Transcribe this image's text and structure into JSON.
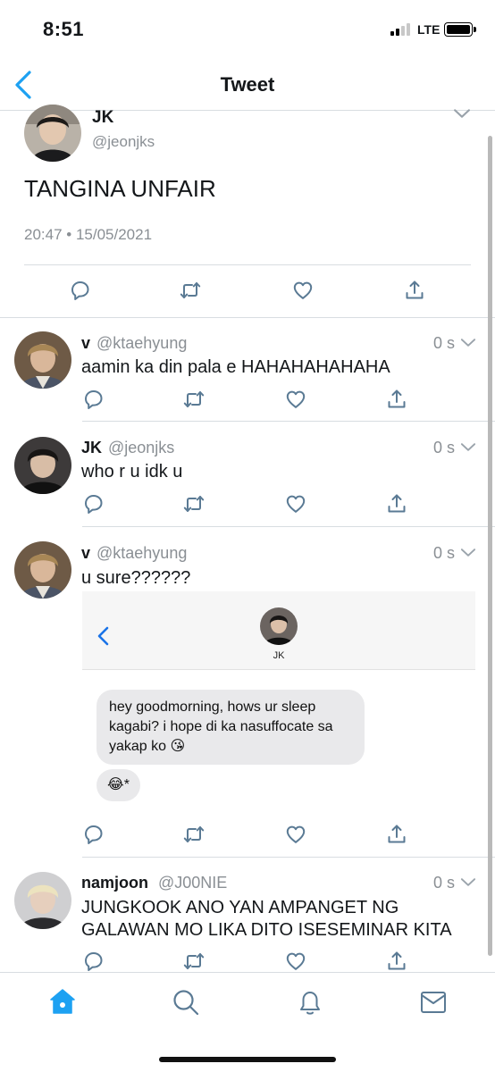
{
  "status_bar": {
    "time": "8:51",
    "network": "LTE"
  },
  "header": {
    "title": "Tweet",
    "back_icon": "chevron-left-icon"
  },
  "main_tweet": {
    "name": "JK",
    "handle": "@jeonjks",
    "text": "TANGINA UNFAIR",
    "datetime": "20:47 • 15/05/2021",
    "actions": [
      "reply-icon",
      "retweet-icon",
      "like-icon",
      "share-icon"
    ]
  },
  "replies": [
    {
      "name": "v",
      "handle": "@ktaehyung",
      "time": "0 s",
      "text": "aamin ka din pala e HAHAHAHAHAHA"
    },
    {
      "name": "JK",
      "handle": "@jeonjks",
      "time": "0 s",
      "text": "who r u idk u"
    },
    {
      "name": "v",
      "handle": "@ktaehyung",
      "time": "0 s",
      "text": "u sure??????",
      "embed": {
        "contact_name": "JK",
        "messages": [
          "hey goodmorning, hows ur sleep kagabi? i hope di ka nasuffocate sa yakap ko 😘",
          "😂*"
        ]
      }
    },
    {
      "name": "namjoon",
      "handle": "@J00NIE",
      "time": "0 s",
      "text": "JUNGKOOK ANO YAN AMPANGET NG GALAWAN MO LIKA DITO ISESEMINAR KITA"
    }
  ],
  "tab_bar": {
    "items": [
      "home-icon",
      "search-icon",
      "notifications-icon",
      "messages-icon"
    ],
    "active": "home-icon"
  },
  "colors": {
    "accent": "#1da1f2",
    "secondary_text": "#8a8f94",
    "divider": "#d8dde1",
    "action_icon": "#5a7a94"
  }
}
